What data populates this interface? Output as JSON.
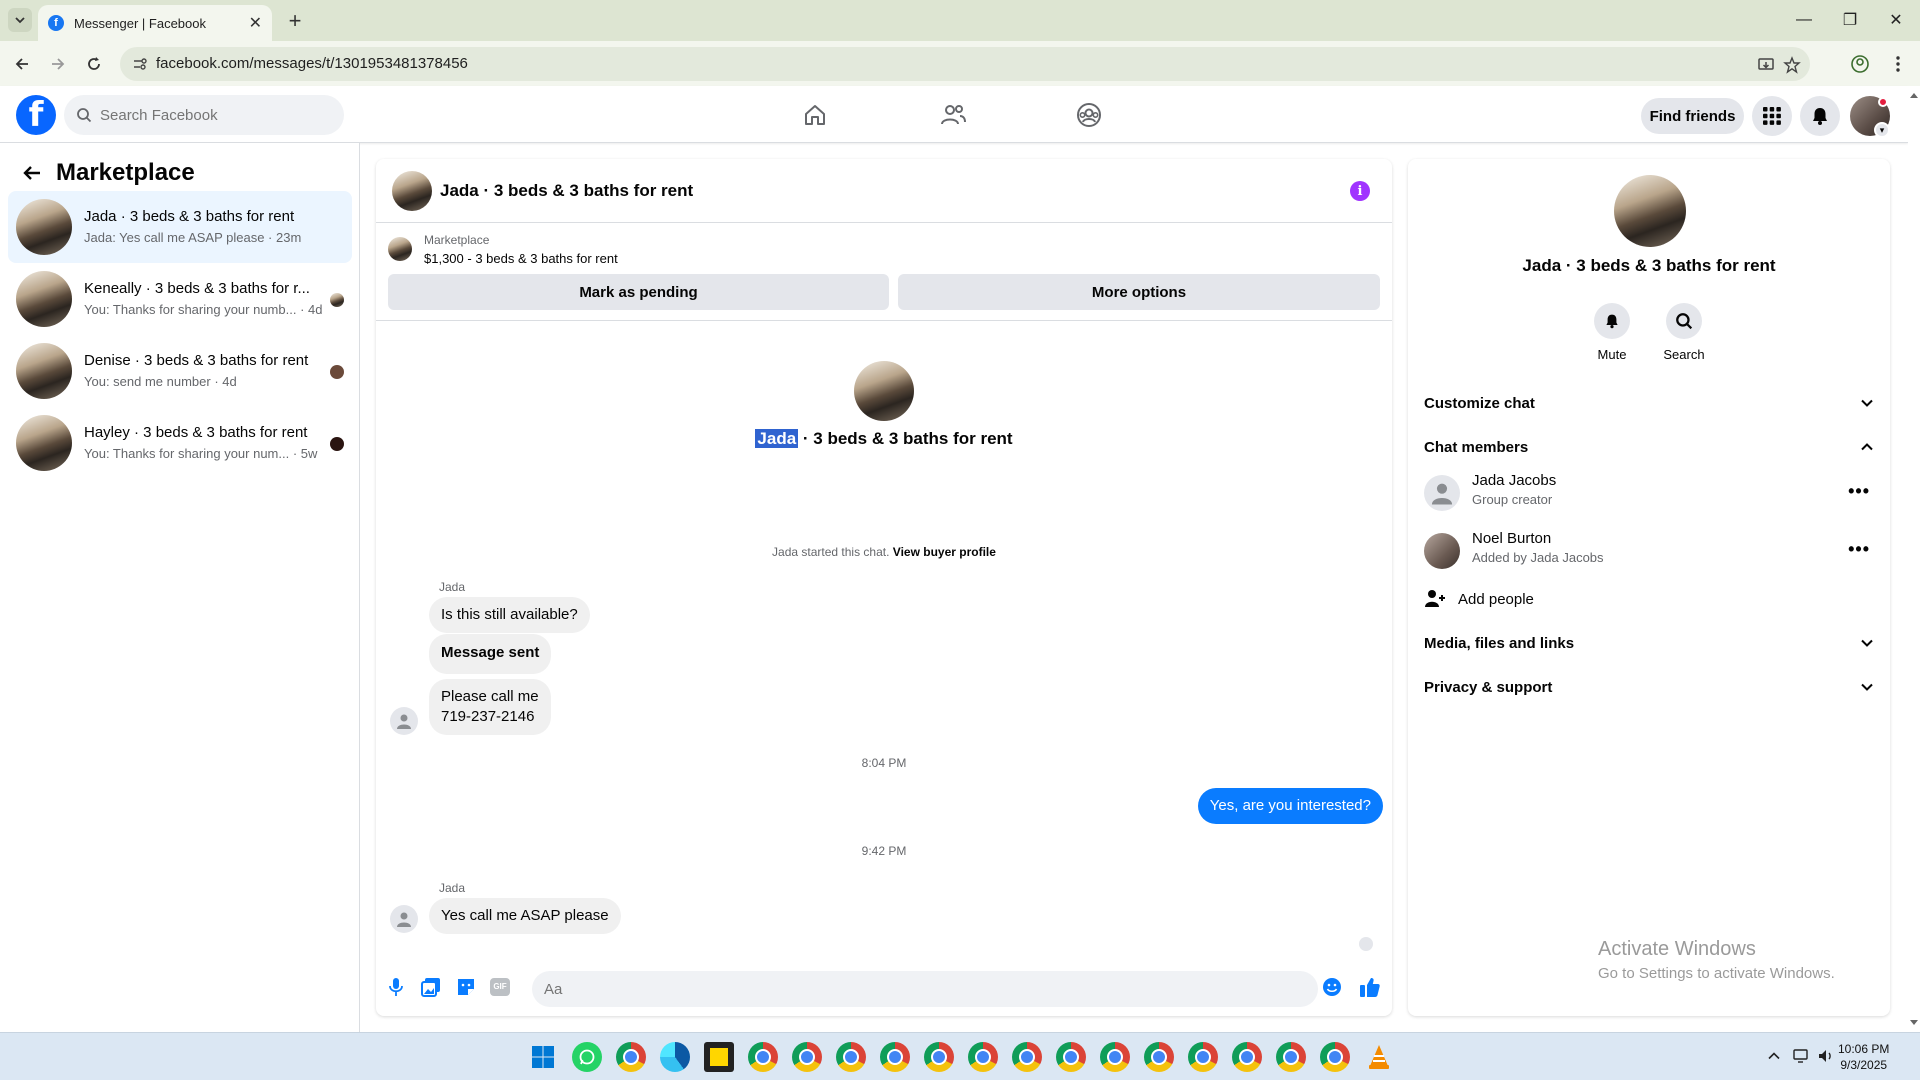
{
  "browser": {
    "tab_title": "Messenger | Facebook",
    "tab_close": "✕",
    "new_tab": "+",
    "url": "facebook.com/messages/t/1301953481378456",
    "window_controls": {
      "minimize": "—",
      "restore": "❐",
      "close": "✕"
    }
  },
  "fb_header": {
    "logo": "f",
    "search_placeholder": "Search Facebook",
    "find_friends": "Find friends"
  },
  "sidebar": {
    "title": "Marketplace",
    "conversations": [
      {
        "name": "Jada · 3 beds & 3 baths for rent",
        "preview": "Jada: Yes call me ASAP please · 23m",
        "active": true
      },
      {
        "name": "Keneally · 3 beds & 3 baths for r...",
        "preview": "You: Thanks for sharing your numb... · 4d"
      },
      {
        "name": "Denise · 3 beds & 3 baths for rent",
        "preview": "You: send me number · 4d"
      },
      {
        "name": "Hayley · 3 beds & 3 baths for rent",
        "preview": "You: Thanks for sharing your num... · 5w"
      }
    ]
  },
  "chat": {
    "title": "Jada · 3 beds & 3 baths for rent",
    "info_icon": "i",
    "marketplace_label": "Marketplace",
    "listing": "$1,300 - 3 beds & 3 baths for rent",
    "mark_pending": "Mark as pending",
    "more_options": "More options",
    "intro_highlight": "Jada",
    "intro_rest": " · 3 beds & 3 baths for rent",
    "started_text": "Jada started this chat. ",
    "view_buyer_profile": "View buyer profile",
    "sender_name": "Jada",
    "messages": {
      "m1": "Is this still available?",
      "m2": "Message sent",
      "m3_line1": "Please call me",
      "m3_line2": "719-237-2146",
      "time1": "8:04 PM",
      "m4": "Yes, are you interested?",
      "time2": "9:42 PM",
      "m5": "Yes call me ASAP please"
    },
    "composer_placeholder": "Aa",
    "gif_label": "GIF"
  },
  "right_panel": {
    "title": "Jada · 3 beds & 3 baths for rent",
    "mute": "Mute",
    "search": "Search",
    "customize_chat": "Customize chat",
    "chat_members": "Chat members",
    "members": [
      {
        "name": "Jada Jacobs",
        "sub": "Group creator"
      },
      {
        "name": "Noel Burton",
        "sub": "Added by Jada Jacobs"
      }
    ],
    "more_dots": "•••",
    "add_people": "Add people",
    "media_files_links": "Media, files and links",
    "privacy_support": "Privacy & support"
  },
  "watermark": {
    "line1": "Activate Windows",
    "line2": "Go to Settings to activate Windows."
  },
  "taskbar": {
    "time": "10:06 PM",
    "date": "9/3/2025"
  },
  "colors": {
    "fb_blue": "#0866ff",
    "messenger_blue": "#0a7cff",
    "info_purple": "#a033ff"
  }
}
